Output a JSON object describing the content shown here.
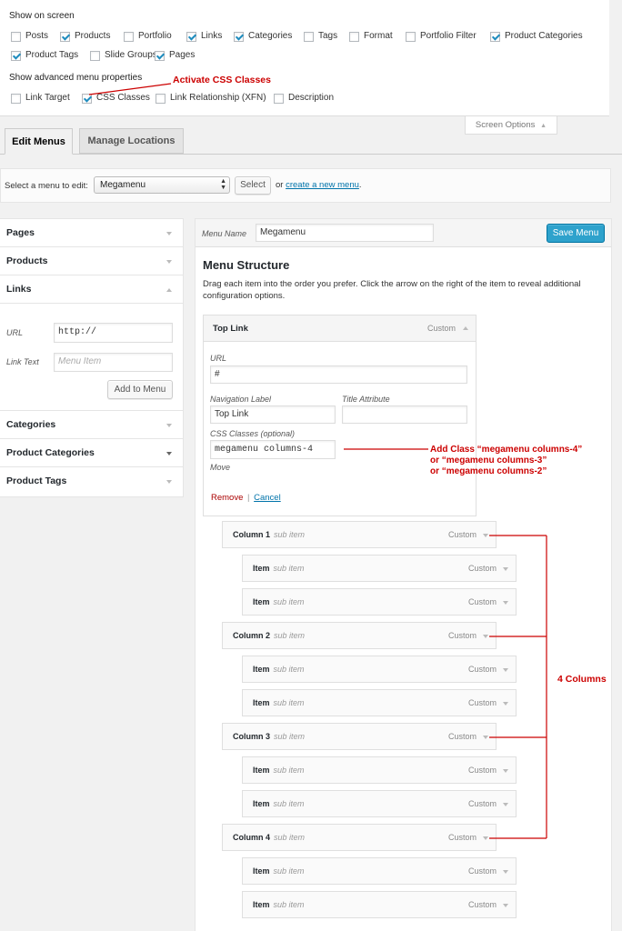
{
  "screen_options": {
    "heading": "Show on screen",
    "row1": [
      {
        "label": "Posts",
        "checked": false
      },
      {
        "label": "Products",
        "checked": true
      },
      {
        "label": "Portfolio",
        "checked": false
      },
      {
        "label": "Links",
        "checked": true
      },
      {
        "label": "Categories",
        "checked": true
      },
      {
        "label": "Tags",
        "checked": false
      },
      {
        "label": "Format",
        "checked": false
      },
      {
        "label": "Portfolio Filter",
        "checked": false
      },
      {
        "label": "Product Categories",
        "checked": true
      }
    ],
    "row2": [
      {
        "label": "Product Tags",
        "checked": true
      },
      {
        "label": "Slide Groups",
        "checked": false
      },
      {
        "label": "Pages",
        "checked": true
      }
    ],
    "advanced_heading": "Show advanced menu properties",
    "advanced": [
      {
        "label": "Link Target",
        "checked": false
      },
      {
        "label": "CSS Classes",
        "checked": true
      },
      {
        "label": "Link Relationship (XFN)",
        "checked": false
      },
      {
        "label": "Description",
        "checked": false
      }
    ],
    "toggle_label": "Screen Options"
  },
  "annotations": {
    "activate_css": "Activate CSS Classes",
    "add_class_1": "Add Class “megamenu columns-4”",
    "add_class_2": "or “megamenu columns-3”",
    "add_class_3": "or “megamenu columns-2”",
    "four_columns": "4 Columns"
  },
  "tabs": {
    "edit_menus": "Edit Menus",
    "manage_locations": "Manage Locations"
  },
  "select_bar": {
    "label": "Select a menu to edit:",
    "selected": "Megamenu",
    "select_button": "Select",
    "or_text": "or",
    "create_link": "create a new menu",
    "period": "."
  },
  "sidebar": {
    "pages": "Pages",
    "products": "Products",
    "links": "Links",
    "url_label": "URL",
    "url_value": "http://",
    "link_text_label": "Link Text",
    "link_text_placeholder": "Menu Item",
    "add_button": "Add to Menu",
    "categories": "Categories",
    "product_categories": "Product Categories",
    "product_tags": "Product Tags"
  },
  "menu": {
    "name_label": "Menu Name",
    "name_value": "Megamenu",
    "save_button": "Save Menu",
    "structure_title": "Menu Structure",
    "structure_desc": "Drag each item into the order you prefer. Click the arrow on the right of the item to reveal additional configuration options."
  },
  "top_link": {
    "title": "Top Link",
    "type": "Custom",
    "url_label": "URL",
    "url_value": "#",
    "nav_label_label": "Navigation Label",
    "nav_label_value": "Top Link",
    "title_attr_label": "Title Attribute",
    "title_attr_value": "",
    "css_label": "CSS Classes (optional)",
    "css_value": "megamenu columns-4",
    "move_label": "Move",
    "remove": "Remove",
    "separator": "|",
    "cancel": "Cancel"
  },
  "columns": [
    {
      "name": "Column 1",
      "sub": "sub item",
      "type": "Custom",
      "items": [
        {
          "name": "Item",
          "sub": "sub item",
          "type": "Custom"
        },
        {
          "name": "Item",
          "sub": "sub item",
          "type": "Custom"
        }
      ]
    },
    {
      "name": "Column 2",
      "sub": "sub item",
      "type": "Custom",
      "items": [
        {
          "name": "Item",
          "sub": "sub item",
          "type": "Custom"
        },
        {
          "name": "Item",
          "sub": "sub item",
          "type": "Custom"
        }
      ]
    },
    {
      "name": "Column 3",
      "sub": "sub item",
      "type": "Custom",
      "items": [
        {
          "name": "Item",
          "sub": "sub item",
          "type": "Custom"
        },
        {
          "name": "Item",
          "sub": "sub item",
          "type": "Custom"
        }
      ]
    },
    {
      "name": "Column 4",
      "sub": "sub item",
      "type": "Custom",
      "items": [
        {
          "name": "Item",
          "sub": "sub item",
          "type": "Custom"
        },
        {
          "name": "Item",
          "sub": "sub item",
          "type": "Custom"
        }
      ]
    }
  ],
  "colors": {
    "accent": "#2ea2cc",
    "annotation": "#cc0000",
    "link": "#0073aa"
  }
}
